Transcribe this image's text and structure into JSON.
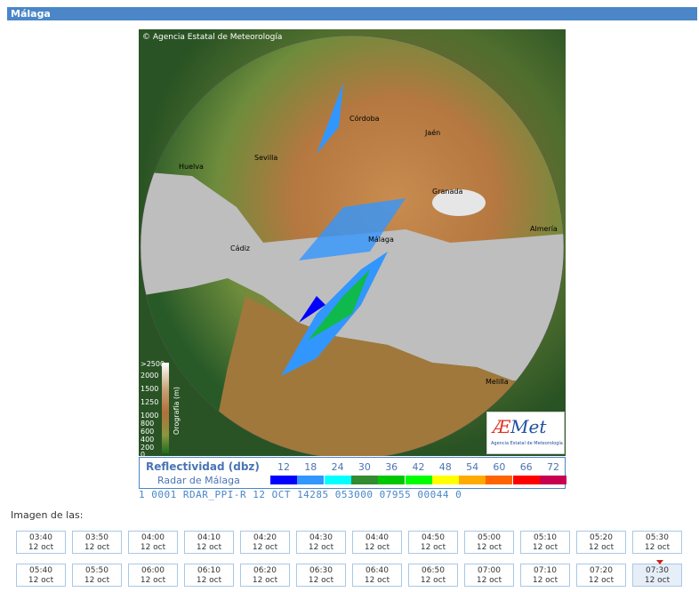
{
  "header": {
    "title": "Málaga"
  },
  "radar": {
    "copyright": "© Agencia Estatal de Meteorología",
    "cities": [
      "Córdoba",
      "Jaén",
      "Sevilla",
      "Huelva",
      "Granada",
      "Málaga",
      "Cádiz",
      "Melilla",
      "Almería"
    ],
    "orography": {
      "title": "Orografía (m)",
      "labels": [
        ">2500",
        "2000",
        "1500",
        "1250",
        "1000",
        "800",
        "600",
        "400",
        "200",
        "0"
      ]
    },
    "logo": {
      "text_a": "Æ",
      "text_b": "Met",
      "sub": "Agencia Estatal de Meteorología"
    }
  },
  "legend": {
    "title": "Reflectividad (dbz)",
    "subtitle": "Radar de Málaga",
    "values": [
      "12",
      "18",
      "24",
      "30",
      "36",
      "42",
      "48",
      "54",
      "60",
      "66",
      "72"
    ],
    "colors": [
      "#0000ff",
      "#3296ff",
      "#00ffff",
      "#328c32",
      "#00c800",
      "#00ff00",
      "#ffff00",
      "#ffaa00",
      "#ff6400",
      "#ff0000",
      "#c80050"
    ]
  },
  "status_line": "1 0001 RDAR_PPI-R   12 OCT 14285 053000 07955 00044 0",
  "image_label": "Imagen de las:",
  "times_row1": [
    {
      "t": "03:40",
      "d": "12 oct"
    },
    {
      "t": "03:50",
      "d": "12 oct"
    },
    {
      "t": "04:00",
      "d": "12 oct"
    },
    {
      "t": "04:10",
      "d": "12 oct"
    },
    {
      "t": "04:20",
      "d": "12 oct"
    },
    {
      "t": "04:30",
      "d": "12 oct"
    },
    {
      "t": "04:40",
      "d": "12 oct"
    },
    {
      "t": "04:50",
      "d": "12 oct"
    },
    {
      "t": "05:00",
      "d": "12 oct"
    },
    {
      "t": "05:10",
      "d": "12 oct"
    },
    {
      "t": "05:20",
      "d": "12 oct"
    },
    {
      "t": "05:30",
      "d": "12 oct"
    }
  ],
  "times_row2": [
    {
      "t": "05:40",
      "d": "12 oct"
    },
    {
      "t": "05:50",
      "d": "12 oct"
    },
    {
      "t": "06:00",
      "d": "12 oct"
    },
    {
      "t": "06:10",
      "d": "12 oct"
    },
    {
      "t": "06:20",
      "d": "12 oct"
    },
    {
      "t": "06:30",
      "d": "12 oct"
    },
    {
      "t": "06:40",
      "d": "12 oct"
    },
    {
      "t": "06:50",
      "d": "12 oct"
    },
    {
      "t": "07:00",
      "d": "12 oct"
    },
    {
      "t": "07:10",
      "d": "12 oct"
    },
    {
      "t": "07:20",
      "d": "12 oct"
    },
    {
      "t": "07:30",
      "d": "12 oct"
    }
  ],
  "selected_time": "07:30"
}
